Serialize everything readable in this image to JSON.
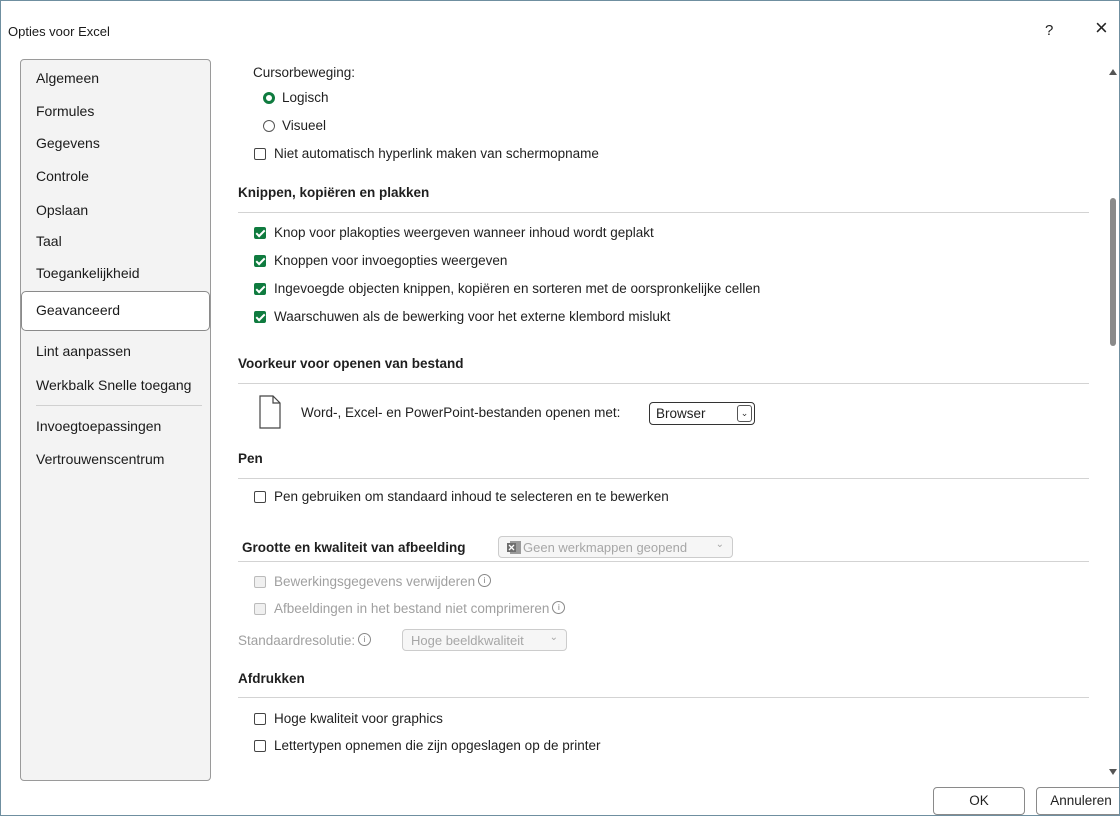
{
  "window": {
    "title": "Opties voor Excel",
    "help": "?",
    "close": "×"
  },
  "nav": {
    "items": [
      "Algemeen",
      "Formules",
      "Gegevens",
      "Controle",
      "Opslaan",
      "Taal",
      "Toegankelijkheid",
      "Geavanceerd",
      "Lint aanpassen",
      "Werkbalk Snelle toegang",
      "Invoegtoepassingen",
      "Vertrouwenscentrum"
    ],
    "selected": "Geavanceerd"
  },
  "cursor": {
    "label": "Cursorbeweging:",
    "logical": "Logisch",
    "visual": "Visueel",
    "selected": "Logisch",
    "no_hyperlink": "Niet automatisch hyperlink maken van schermopname"
  },
  "clipboard": {
    "heading": "Knippen, kopiëren en plakken",
    "paste_options": "Knop voor plakopties weergeven wanneer inhoud wordt geplakt",
    "insert_options": "Knoppen voor invoegopties weergeven",
    "cut_objects": "Ingevoegde objecten knippen, kopiëren en sorteren met de oorspronkelijke cellen",
    "warn_external": "Waarschuwen als de bewerking voor het externe klembord mislukt"
  },
  "open_pref": {
    "heading": "Voorkeur voor openen van bestand",
    "label": "Word-, Excel- en PowerPoint-bestanden openen met:",
    "value": "Browser"
  },
  "pen": {
    "heading": "Pen",
    "use_pen": "Pen gebruiken om standaard inhoud te selecteren en te bewerken"
  },
  "image": {
    "heading": "Grootte en kwaliteit van afbeelding",
    "workbook": "Geen werkmappen geopend",
    "discard": "Bewerkingsgegevens verwijderen",
    "no_compress": "Afbeeldingen in het bestand niet comprimeren",
    "resolution_label": "Standaardresolutie:",
    "resolution_value": "Hoge beeldkwaliteit"
  },
  "print": {
    "heading": "Afdrukken",
    "high_quality": "Hoge kwaliteit voor graphics",
    "fonts": "Lettertypen opnemen die zijn opgeslagen op de printer"
  },
  "buttons": {
    "ok": "OK",
    "cancel": "Annuleren"
  },
  "colors": {
    "accent": "#0f7b3f"
  }
}
